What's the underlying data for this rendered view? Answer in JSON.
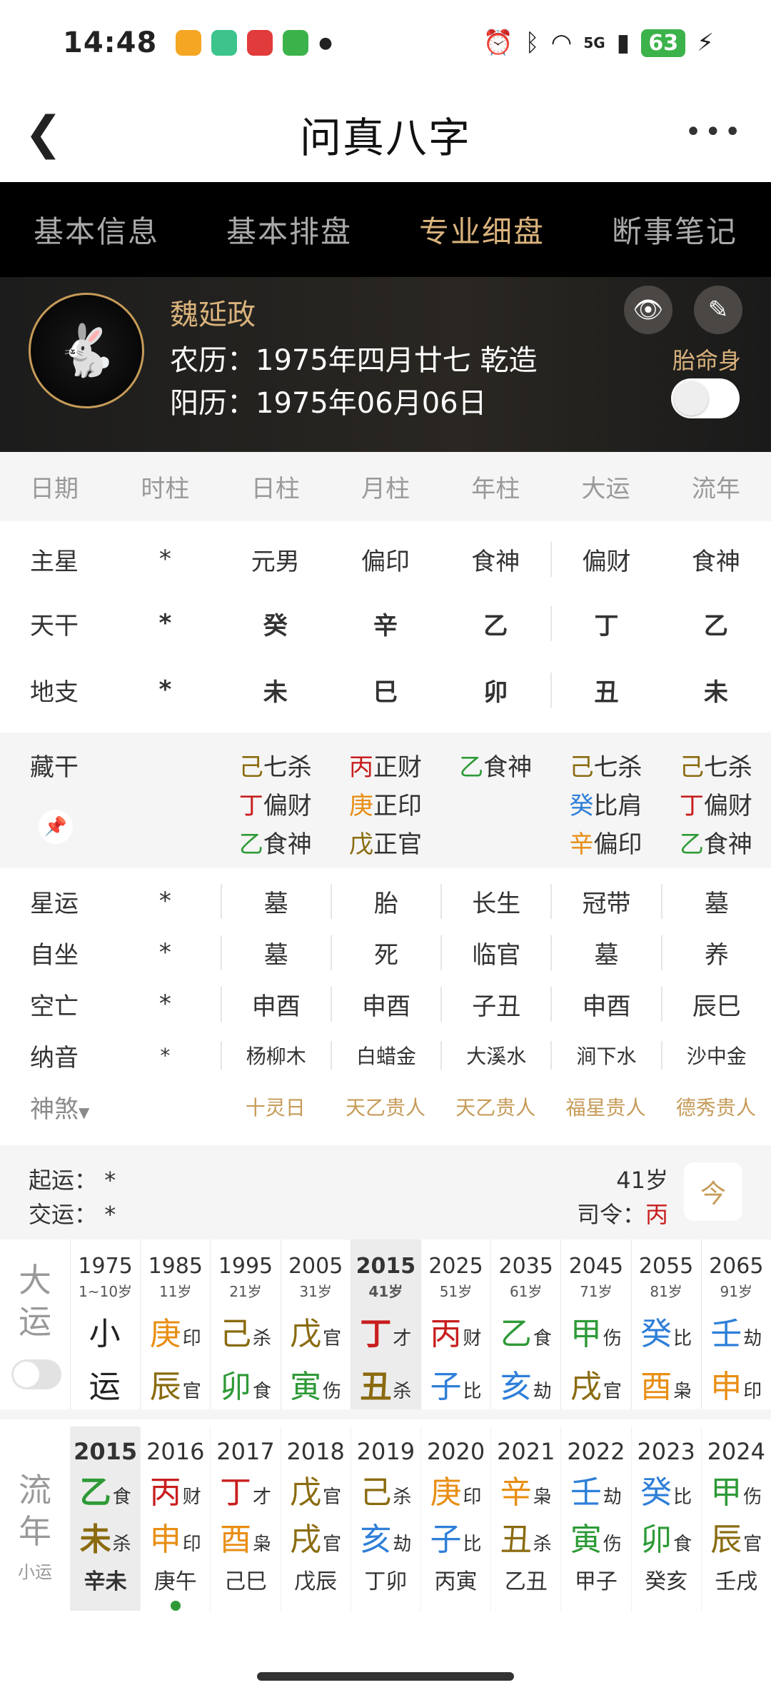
{
  "status": {
    "time": "14:48",
    "battery": "63",
    "network": "5G"
  },
  "header": {
    "title": "问真八字"
  },
  "tabs": [
    "基本信息",
    "基本排盘",
    "专业细盘",
    "断事笔记"
  ],
  "profile": {
    "name": "魏延政",
    "lunar": "农历：1975年四月廿七 乾造",
    "solar": "阳历：1975年06月06日",
    "toggle_label": "胎命身"
  },
  "columns": [
    "日期",
    "时柱",
    "日柱",
    "月柱",
    "年柱",
    "大运",
    "流年"
  ],
  "pillars": {
    "zhuxing": {
      "label": "主星",
      "values": [
        "*",
        "元男",
        "偏印",
        "食神",
        "偏财",
        "食神"
      ]
    },
    "tiangan": {
      "label": "天干",
      "values": [
        "*",
        "癸",
        "辛",
        "乙",
        "丁",
        "乙"
      ],
      "colors": [
        "#999999",
        "#2e7fd8",
        "#e88e14",
        "#2e9a37",
        "#c81e1e",
        "#2e9a37"
      ]
    },
    "dizhi": {
      "label": "地支",
      "values": [
        "*",
        "未",
        "巳",
        "卯",
        "丑",
        "未"
      ],
      "colors": [
        "#999999",
        "#8a6b0f",
        "#c81e1e",
        "#2e9a37",
        "#8a6b0f",
        "#8a6b0f"
      ]
    }
  },
  "canggan": {
    "label": "藏干",
    "cols": [
      [],
      [
        {
          "g": "己",
          "t": "七杀",
          "c": "#8a6b0f"
        },
        {
          "g": "丁",
          "t": "偏财",
          "c": "#c81e1e"
        },
        {
          "g": "乙",
          "t": "食神",
          "c": "#2e9a37"
        }
      ],
      [
        {
          "g": "丙",
          "t": "正财",
          "c": "#c81e1e"
        },
        {
          "g": "庚",
          "t": "正印",
          "c": "#e88e14"
        },
        {
          "g": "戊",
          "t": "正官",
          "c": "#8a6b0f"
        }
      ],
      [
        {
          "g": "乙",
          "t": "食神",
          "c": "#2e9a37"
        }
      ],
      [
        {
          "g": "己",
          "t": "七杀",
          "c": "#8a6b0f"
        },
        {
          "g": "癸",
          "t": "比肩",
          "c": "#2e7fd8"
        },
        {
          "g": "辛",
          "t": "偏印",
          "c": "#e88e14"
        }
      ],
      [
        {
          "g": "己",
          "t": "七杀",
          "c": "#8a6b0f"
        },
        {
          "g": "丁",
          "t": "偏财",
          "c": "#c81e1e"
        },
        {
          "g": "乙",
          "t": "食神",
          "c": "#2e9a37"
        }
      ]
    ]
  },
  "detail": [
    {
      "label": "星运",
      "values": [
        "*",
        "墓",
        "胎",
        "长生",
        "冠带",
        "墓"
      ]
    },
    {
      "label": "自坐",
      "values": [
        "*",
        "墓",
        "死",
        "临官",
        "墓",
        "养"
      ]
    },
    {
      "label": "空亡",
      "values": [
        "*",
        "申酉",
        "申酉",
        "子丑",
        "申酉",
        "辰巳"
      ]
    },
    {
      "label": "纳音",
      "values": [
        "*",
        "杨柳木",
        "白蜡金",
        "大溪水",
        "涧下水",
        "沙中金"
      ]
    }
  ],
  "shensha": {
    "label": "神煞",
    "values": [
      "",
      "十灵日",
      "天乙贵人",
      "天乙贵人",
      "福星贵人",
      "德秀贵人"
    ]
  },
  "qiyun": {
    "start_label": "起运：",
    "start_value": "*",
    "jiao_label": "交运：",
    "jiao_value": "*",
    "age": "41岁",
    "siling_label": "司令：",
    "siling_value": "丙",
    "cal_icon": "今"
  },
  "dayun": {
    "label": [
      "大",
      "运"
    ],
    "cells": [
      {
        "yr": "1975",
        "age": "1~10岁",
        "g": "小",
        "gt": "",
        "gc": "#222222",
        "z": "运",
        "zt": "",
        "zc": "#222222"
      },
      {
        "yr": "1985",
        "age": "11岁",
        "g": "庚",
        "gt": "印",
        "gc": "#e88e14",
        "z": "辰",
        "zt": "官",
        "zc": "#8a6b0f"
      },
      {
        "yr": "1995",
        "age": "21岁",
        "g": "己",
        "gt": "杀",
        "gc": "#8a6b0f",
        "z": "卯",
        "zt": "食",
        "zc": "#2e9a37"
      },
      {
        "yr": "2005",
        "age": "31岁",
        "g": "戊",
        "gt": "官",
        "gc": "#8a6b0f",
        "z": "寅",
        "zt": "伤",
        "zc": "#2e9a37"
      },
      {
        "yr": "2015",
        "age": "41岁",
        "g": "丁",
        "gt": "才",
        "gc": "#c81e1e",
        "z": "丑",
        "zt": "杀",
        "zc": "#8a6b0f",
        "sel": true
      },
      {
        "yr": "2025",
        "age": "51岁",
        "g": "丙",
        "gt": "财",
        "gc": "#c81e1e",
        "z": "子",
        "zt": "比",
        "zc": "#2e7fd8"
      },
      {
        "yr": "2035",
        "age": "61岁",
        "g": "乙",
        "gt": "食",
        "gc": "#2e9a37",
        "z": "亥",
        "zt": "劫",
        "zc": "#2e7fd8"
      },
      {
        "yr": "2045",
        "age": "71岁",
        "g": "甲",
        "gt": "伤",
        "gc": "#2e9a37",
        "z": "戌",
        "zt": "官",
        "zc": "#8a6b0f"
      },
      {
        "yr": "2055",
        "age": "81岁",
        "g": "癸",
        "gt": "比",
        "gc": "#2e7fd8",
        "z": "酉",
        "zt": "枭",
        "zc": "#e88e14"
      },
      {
        "yr": "2065",
        "age": "91岁",
        "g": "壬",
        "gt": "劫",
        "gc": "#2e7fd8",
        "z": "申",
        "zt": "印",
        "zc": "#e88e14"
      }
    ]
  },
  "liunian": {
    "label": [
      "流",
      "年"
    ],
    "sublabel": "小运",
    "cells": [
      {
        "yr": "2015",
        "g": "乙",
        "gt": "食",
        "gc": "#2e9a37",
        "z": "未",
        "zt": "杀",
        "zc": "#8a6b0f",
        "xy": "辛未",
        "sel": true
      },
      {
        "yr": "2016",
        "g": "丙",
        "gt": "财",
        "gc": "#c81e1e",
        "z": "申",
        "zt": "印",
        "zc": "#e88e14",
        "xy": "庚午",
        "dot": true
      },
      {
        "yr": "2017",
        "g": "丁",
        "gt": "才",
        "gc": "#c81e1e",
        "z": "酉",
        "zt": "枭",
        "zc": "#e88e14",
        "xy": "己巳"
      },
      {
        "yr": "2018",
        "g": "戊",
        "gt": "官",
        "gc": "#8a6b0f",
        "z": "戌",
        "zt": "官",
        "zc": "#8a6b0f",
        "xy": "戊辰"
      },
      {
        "yr": "2019",
        "g": "己",
        "gt": "杀",
        "gc": "#8a6b0f",
        "z": "亥",
        "zt": "劫",
        "zc": "#2e7fd8",
        "xy": "丁卯"
      },
      {
        "yr": "2020",
        "g": "庚",
        "gt": "印",
        "gc": "#e88e14",
        "z": "子",
        "zt": "比",
        "zc": "#2e7fd8",
        "xy": "丙寅"
      },
      {
        "yr": "2021",
        "g": "辛",
        "gt": "枭",
        "gc": "#e88e14",
        "z": "丑",
        "zt": "杀",
        "zc": "#8a6b0f",
        "xy": "乙丑"
      },
      {
        "yr": "2022",
        "g": "壬",
        "gt": "劫",
        "gc": "#2e7fd8",
        "z": "寅",
        "zt": "伤",
        "zc": "#2e9a37",
        "xy": "甲子"
      },
      {
        "yr": "2023",
        "g": "癸",
        "gt": "比",
        "gc": "#2e7fd8",
        "z": "卯",
        "zt": "食",
        "zc": "#2e9a37",
        "xy": "癸亥"
      },
      {
        "yr": "2024",
        "g": "甲",
        "gt": "伤",
        "gc": "#2e9a37",
        "z": "辰",
        "zt": "官",
        "zc": "#8a6b0f",
        "xy": "壬戌"
      }
    ]
  }
}
